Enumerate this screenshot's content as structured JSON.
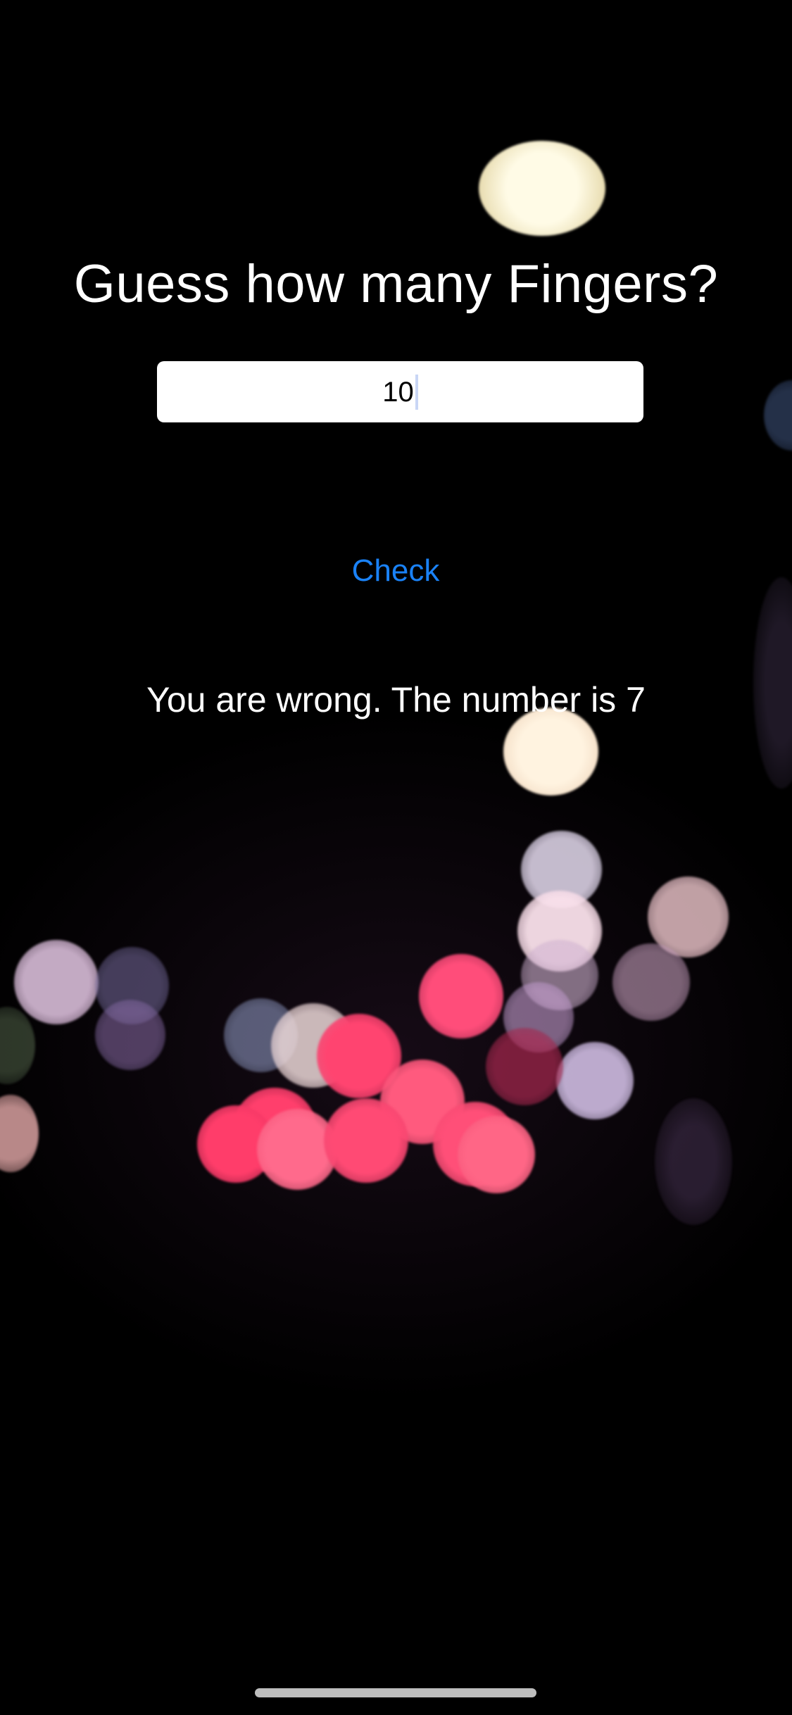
{
  "app": {
    "title": "Guess how many Fingers?"
  },
  "guess_input": {
    "value": "10"
  },
  "check_button": {
    "label": "Check"
  },
  "result": {
    "message": "You are wrong. The number is 7"
  },
  "colors": {
    "background": "#000000",
    "text": "#ffffff",
    "accent": "#1a82f7",
    "input_background": "#ffffff"
  }
}
